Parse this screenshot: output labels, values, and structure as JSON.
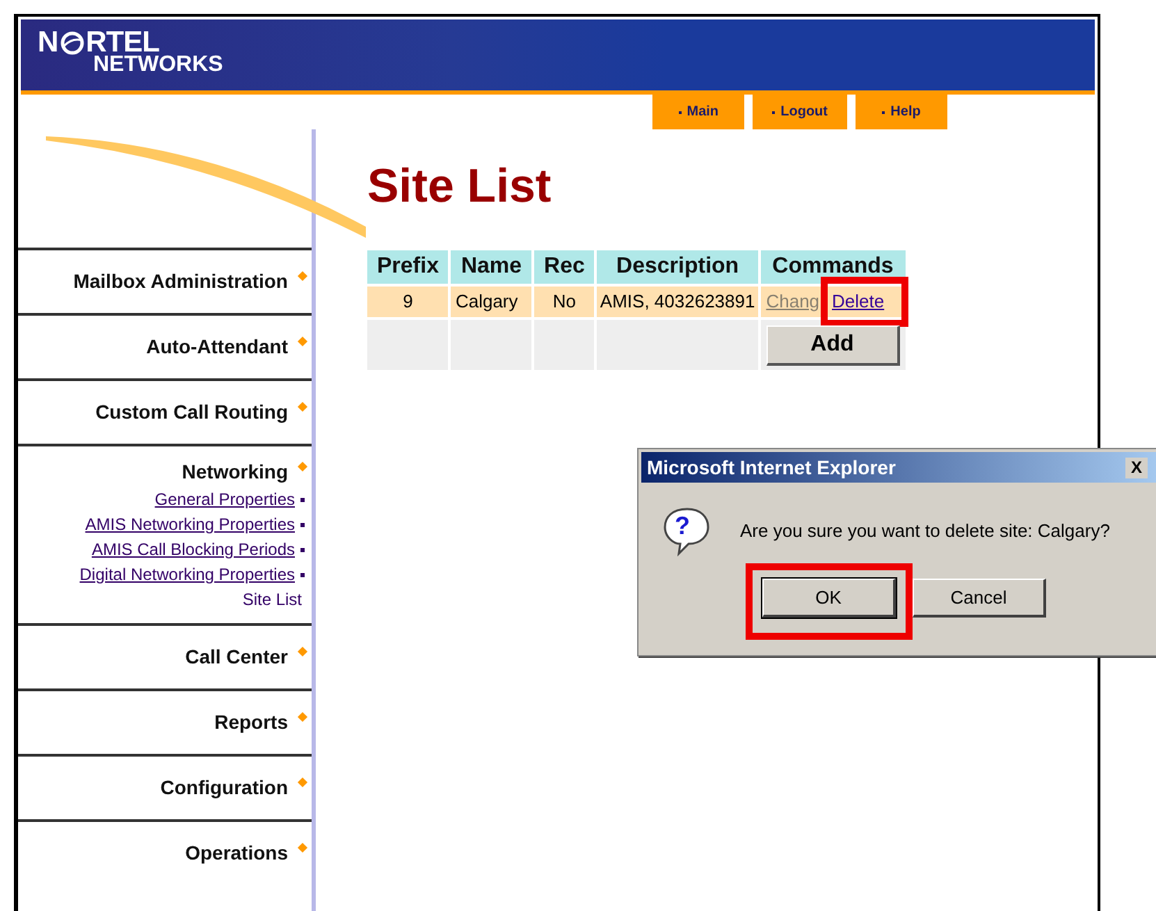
{
  "logo": {
    "top_left": "N",
    "top_right": "RTEL",
    "bottom": "NETWORKS"
  },
  "nav_buttons": [
    "Main",
    "Logout",
    "Help"
  ],
  "sidebar": {
    "items": [
      {
        "label": "Mailbox Administration"
      },
      {
        "label": "Auto-Attendant"
      },
      {
        "label": "Custom Call Routing"
      },
      {
        "label": "Networking",
        "children": [
          {
            "label": "General Properties",
            "selected": false
          },
          {
            "label": "AMIS Networking Properties",
            "selected": false
          },
          {
            "label": "AMIS Call Blocking Periods",
            "selected": false
          },
          {
            "label": "Digital Networking Properties",
            "selected": false
          },
          {
            "label": "Site List",
            "selected": true
          }
        ]
      },
      {
        "label": "Call Center"
      },
      {
        "label": "Reports"
      },
      {
        "label": "Configuration"
      },
      {
        "label": "Operations"
      }
    ]
  },
  "page_title": "Site List",
  "table": {
    "columns": [
      "Prefix",
      "Name",
      "Rec",
      "Description",
      "Commands"
    ],
    "rows": [
      {
        "prefix": "9",
        "name": "Calgary",
        "rec": "No",
        "description": "AMIS, 4032623891",
        "commands": [
          "Chang",
          "Delete"
        ]
      }
    ],
    "add_button": "Add"
  },
  "dialog": {
    "title": "Microsoft Internet Explorer",
    "close": "X",
    "icon_glyph": "?",
    "message": "Are you sure you want to delete site: Calgary?",
    "buttons": [
      "OK",
      "Cancel"
    ]
  }
}
